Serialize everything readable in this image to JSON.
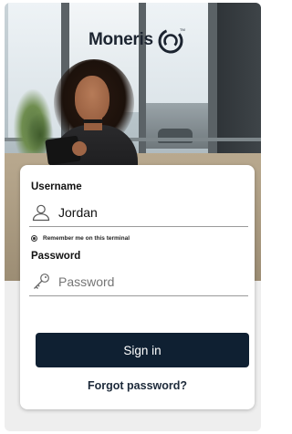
{
  "brand": {
    "name": "Moneris",
    "trademark": "TM"
  },
  "login": {
    "username_label": "Username",
    "username_value": "Jordan",
    "remember_label": "Remember me on this terminal",
    "password_label": "Password",
    "password_placeholder": "Password",
    "signin_label": "Sign in",
    "forgot_label": "Forgot password?"
  },
  "icons": {
    "username": "user-icon",
    "password": "key-icon",
    "remember": "radio-icon"
  },
  "colors": {
    "button_bg": "#0f2032",
    "logo": "#1c2430",
    "card_bg": "#ffffff"
  }
}
